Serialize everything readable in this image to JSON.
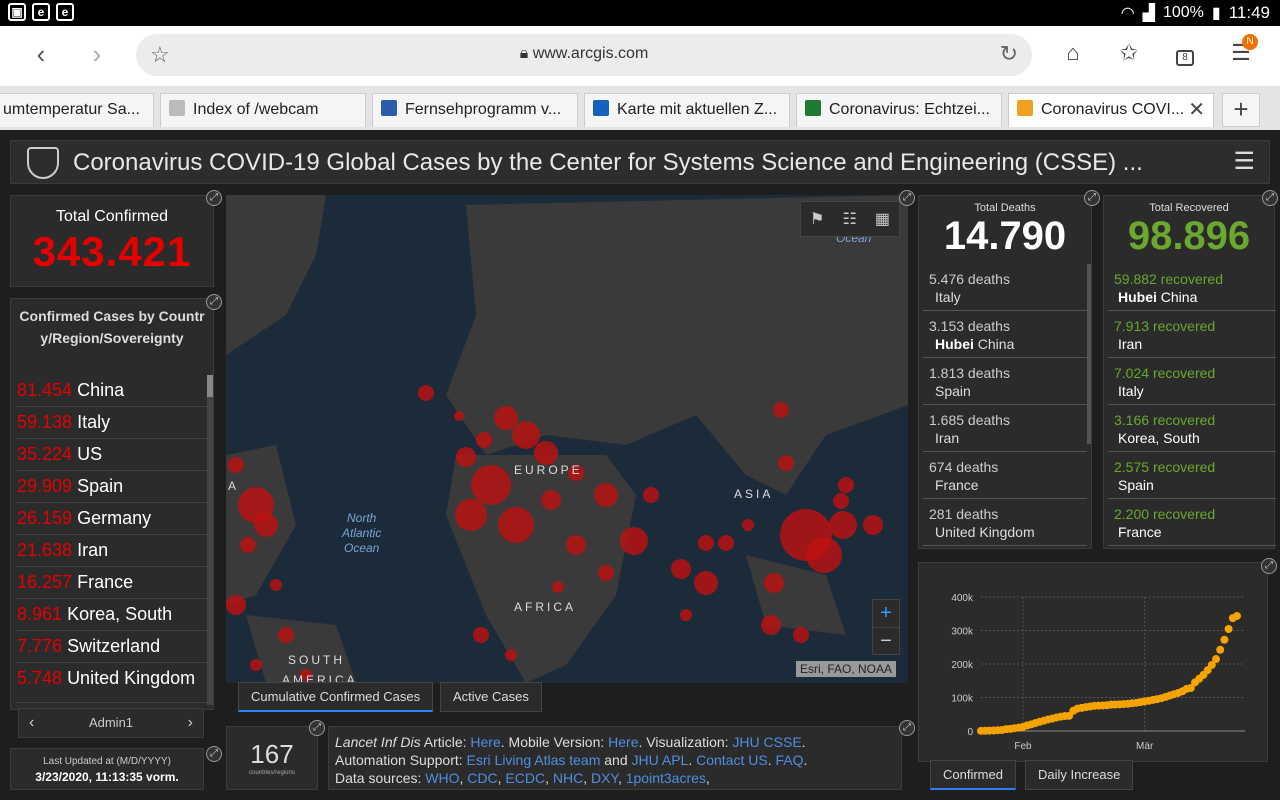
{
  "status_bar": {
    "battery": "100%",
    "time": "11:49"
  },
  "browser": {
    "url": "www.arcgis.com",
    "menu_badge": "N",
    "tabs_count": "8",
    "tabs": [
      {
        "label": "umtemperatur Sa...",
        "color": "#dddddd"
      },
      {
        "label": "Index of /webcam",
        "color": "#bbbbbb"
      },
      {
        "label": "Fernsehprogramm v...",
        "color": "#2a5caa"
      },
      {
        "label": "Karte mit aktuellen Z...",
        "color": "#1560c0"
      },
      {
        "label": "Coronavirus: Echtzei...",
        "color": "#1e7a30"
      },
      {
        "label": "Coronavirus COVI...",
        "color": "#f0a020"
      }
    ]
  },
  "dashboard": {
    "title": "Coronavirus COVID-19 Global Cases by the Center for Systems Science and Engineering (CSSE) ...",
    "total_confirmed": {
      "label": "Total Confirmed",
      "value": "343.421"
    },
    "confirmed_list": {
      "heading": "Confirmed Cases by Country/Region/Sovereignty",
      "rows": [
        {
          "n": "81.454",
          "place": "China"
        },
        {
          "n": "59.138",
          "place": "Italy"
        },
        {
          "n": "35.224",
          "place": "US"
        },
        {
          "n": "29.909",
          "place": "Spain"
        },
        {
          "n": "26.159",
          "place": "Germany"
        },
        {
          "n": "21.638",
          "place": "Iran"
        },
        {
          "n": "16.257",
          "place": "France"
        },
        {
          "n": "8.961",
          "place": "Korea, South"
        },
        {
          "n": "7.776",
          "place": "Switzerland"
        },
        {
          "n": "5.748",
          "place": "United Kingdom"
        }
      ]
    },
    "pager_label": "Admin1",
    "last_updated": {
      "label": "Last Updated at (M/D/YYYY)",
      "value": "3/23/2020, 11:13:35 vorm."
    },
    "map": {
      "labels": {
        "europe": "EUROPE",
        "asia": "ASIA",
        "africa": "AFRICA",
        "south_america_1": "SOUTH",
        "south_america_2": "AMERICA",
        "north_atlantic": "North\nAtlantic\nOcean",
        "ocean_top": "Ocean",
        "a_edge": "A"
      },
      "attribution": "Esri, FAO, NOAA",
      "tabs": [
        "Cumulative Confirmed Cases",
        "Active Cases"
      ]
    },
    "countries": {
      "value": "167",
      "label": "countries/regions"
    },
    "info": {
      "line1": [
        [
          "Lancet Inf Dis",
          "i"
        ],
        [
          " Article: ",
          "t"
        ],
        [
          "Here",
          "a"
        ],
        [
          ". Mobile Version: ",
          "t"
        ],
        [
          "Here",
          "a"
        ],
        [
          ". Visualization: ",
          "t"
        ],
        [
          "JHU CSSE",
          "a"
        ],
        [
          ".",
          "t"
        ]
      ],
      "line2": [
        [
          "Automation Support: ",
          "t"
        ],
        [
          "Esri Living Atlas team",
          "a"
        ],
        [
          " and ",
          "t"
        ],
        [
          "JHU APL",
          "a"
        ],
        [
          ". ",
          "t"
        ],
        [
          "Contact US",
          "a"
        ],
        [
          ". ",
          "t"
        ],
        [
          "FAQ",
          "a"
        ],
        [
          ".",
          "t"
        ]
      ],
      "line3": [
        [
          "Data sources: ",
          "t"
        ],
        [
          "WHO",
          "a"
        ],
        [
          ", ",
          "t"
        ],
        [
          "CDC",
          "a"
        ],
        [
          ", ",
          "t"
        ],
        [
          "ECDC",
          "a"
        ],
        [
          ", ",
          "t"
        ],
        [
          "NHC",
          "a"
        ],
        [
          ", ",
          "t"
        ],
        [
          "DXY",
          "a"
        ],
        [
          ", ",
          "t"
        ],
        [
          "1point3acres",
          "a"
        ],
        [
          ",",
          "t"
        ]
      ]
    },
    "deaths": {
      "label": "Total Deaths",
      "value": "14.790",
      "rows": [
        {
          "v": "5.476 deaths",
          "bold": "",
          "place": "Italy"
        },
        {
          "v": "3.153 deaths",
          "bold": "Hubei",
          "place": "China"
        },
        {
          "v": "1.813 deaths",
          "bold": "",
          "place": "Spain"
        },
        {
          "v": "1.685 deaths",
          "bold": "",
          "place": "Iran"
        },
        {
          "v": "674 deaths",
          "bold": "",
          "place": "France"
        },
        {
          "v": "281 deaths",
          "bold": "",
          "place": "United Kingdom"
        }
      ]
    },
    "recovered": {
      "label": "Total Recovered",
      "value": "98.896",
      "rows": [
        {
          "n": "59.882",
          "w": "recovered",
          "bold": "Hubei",
          "place": "China"
        },
        {
          "n": "7.913",
          "w": "recovered",
          "bold": "",
          "place": "Iran"
        },
        {
          "n": "7.024",
          "w": "recovered",
          "bold": "",
          "place": "Italy"
        },
        {
          "n": "3.166",
          "w": "recovered",
          "bold": "",
          "place": "Korea, South"
        },
        {
          "n": "2.575",
          "w": "recovered",
          "bold": "",
          "place": "Spain"
        },
        {
          "n": "2.200",
          "w": "recovered",
          "bold": "",
          "place": "France"
        }
      ]
    },
    "chart_tabs": [
      "Confirmed",
      "Daily Increase"
    ]
  },
  "colors": {
    "confirmed_red": "#e60000",
    "recovered_green": "#6aa82e",
    "chart_orange": "#f5a300",
    "link_blue": "#4f8fe0"
  },
  "chart_data": {
    "type": "scatter",
    "x_tick_labels": [
      "Feb",
      "Mär"
    ],
    "y_tick_labels": [
      "0",
      "100k",
      "200k",
      "300k",
      "400k"
    ],
    "ylim": [
      0,
      400000
    ],
    "x_days": [
      0,
      1,
      2,
      3,
      4,
      5,
      6,
      7,
      8,
      9,
      10,
      11,
      12,
      13,
      14,
      15,
      16,
      17,
      18,
      19,
      20,
      21,
      22,
      23,
      24,
      25,
      26,
      27,
      28,
      29,
      30,
      31,
      32,
      33,
      34,
      35,
      36,
      37,
      38,
      39,
      40,
      41,
      42,
      43,
      44,
      45,
      46,
      47,
      48,
      49,
      50,
      51,
      52,
      53,
      54,
      55,
      56,
      57,
      58,
      59,
      60,
      61
    ],
    "values": [
      555,
      654,
      941,
      1434,
      2118,
      2927,
      5578,
      6166,
      8234,
      9927,
      12038,
      16787,
      19881,
      23892,
      27635,
      30817,
      34391,
      37120,
      40150,
      42762,
      44802,
      45221,
      60368,
      66885,
      69030,
      71224,
      73258,
      75136,
      75639,
      76197,
      76819,
      78572,
      78958,
      79561,
      80406,
      81388,
      82746,
      84112,
      86011,
      88369,
      90306,
      92840,
      95120,
      97886,
      101801,
      105847,
      109821,
      113590,
      118620,
      125875,
      128352,
      145205,
      156101,
      167454,
      181574,
      197102,
      214821,
      242570,
      272208,
      304507,
      336953,
      343421
    ]
  }
}
